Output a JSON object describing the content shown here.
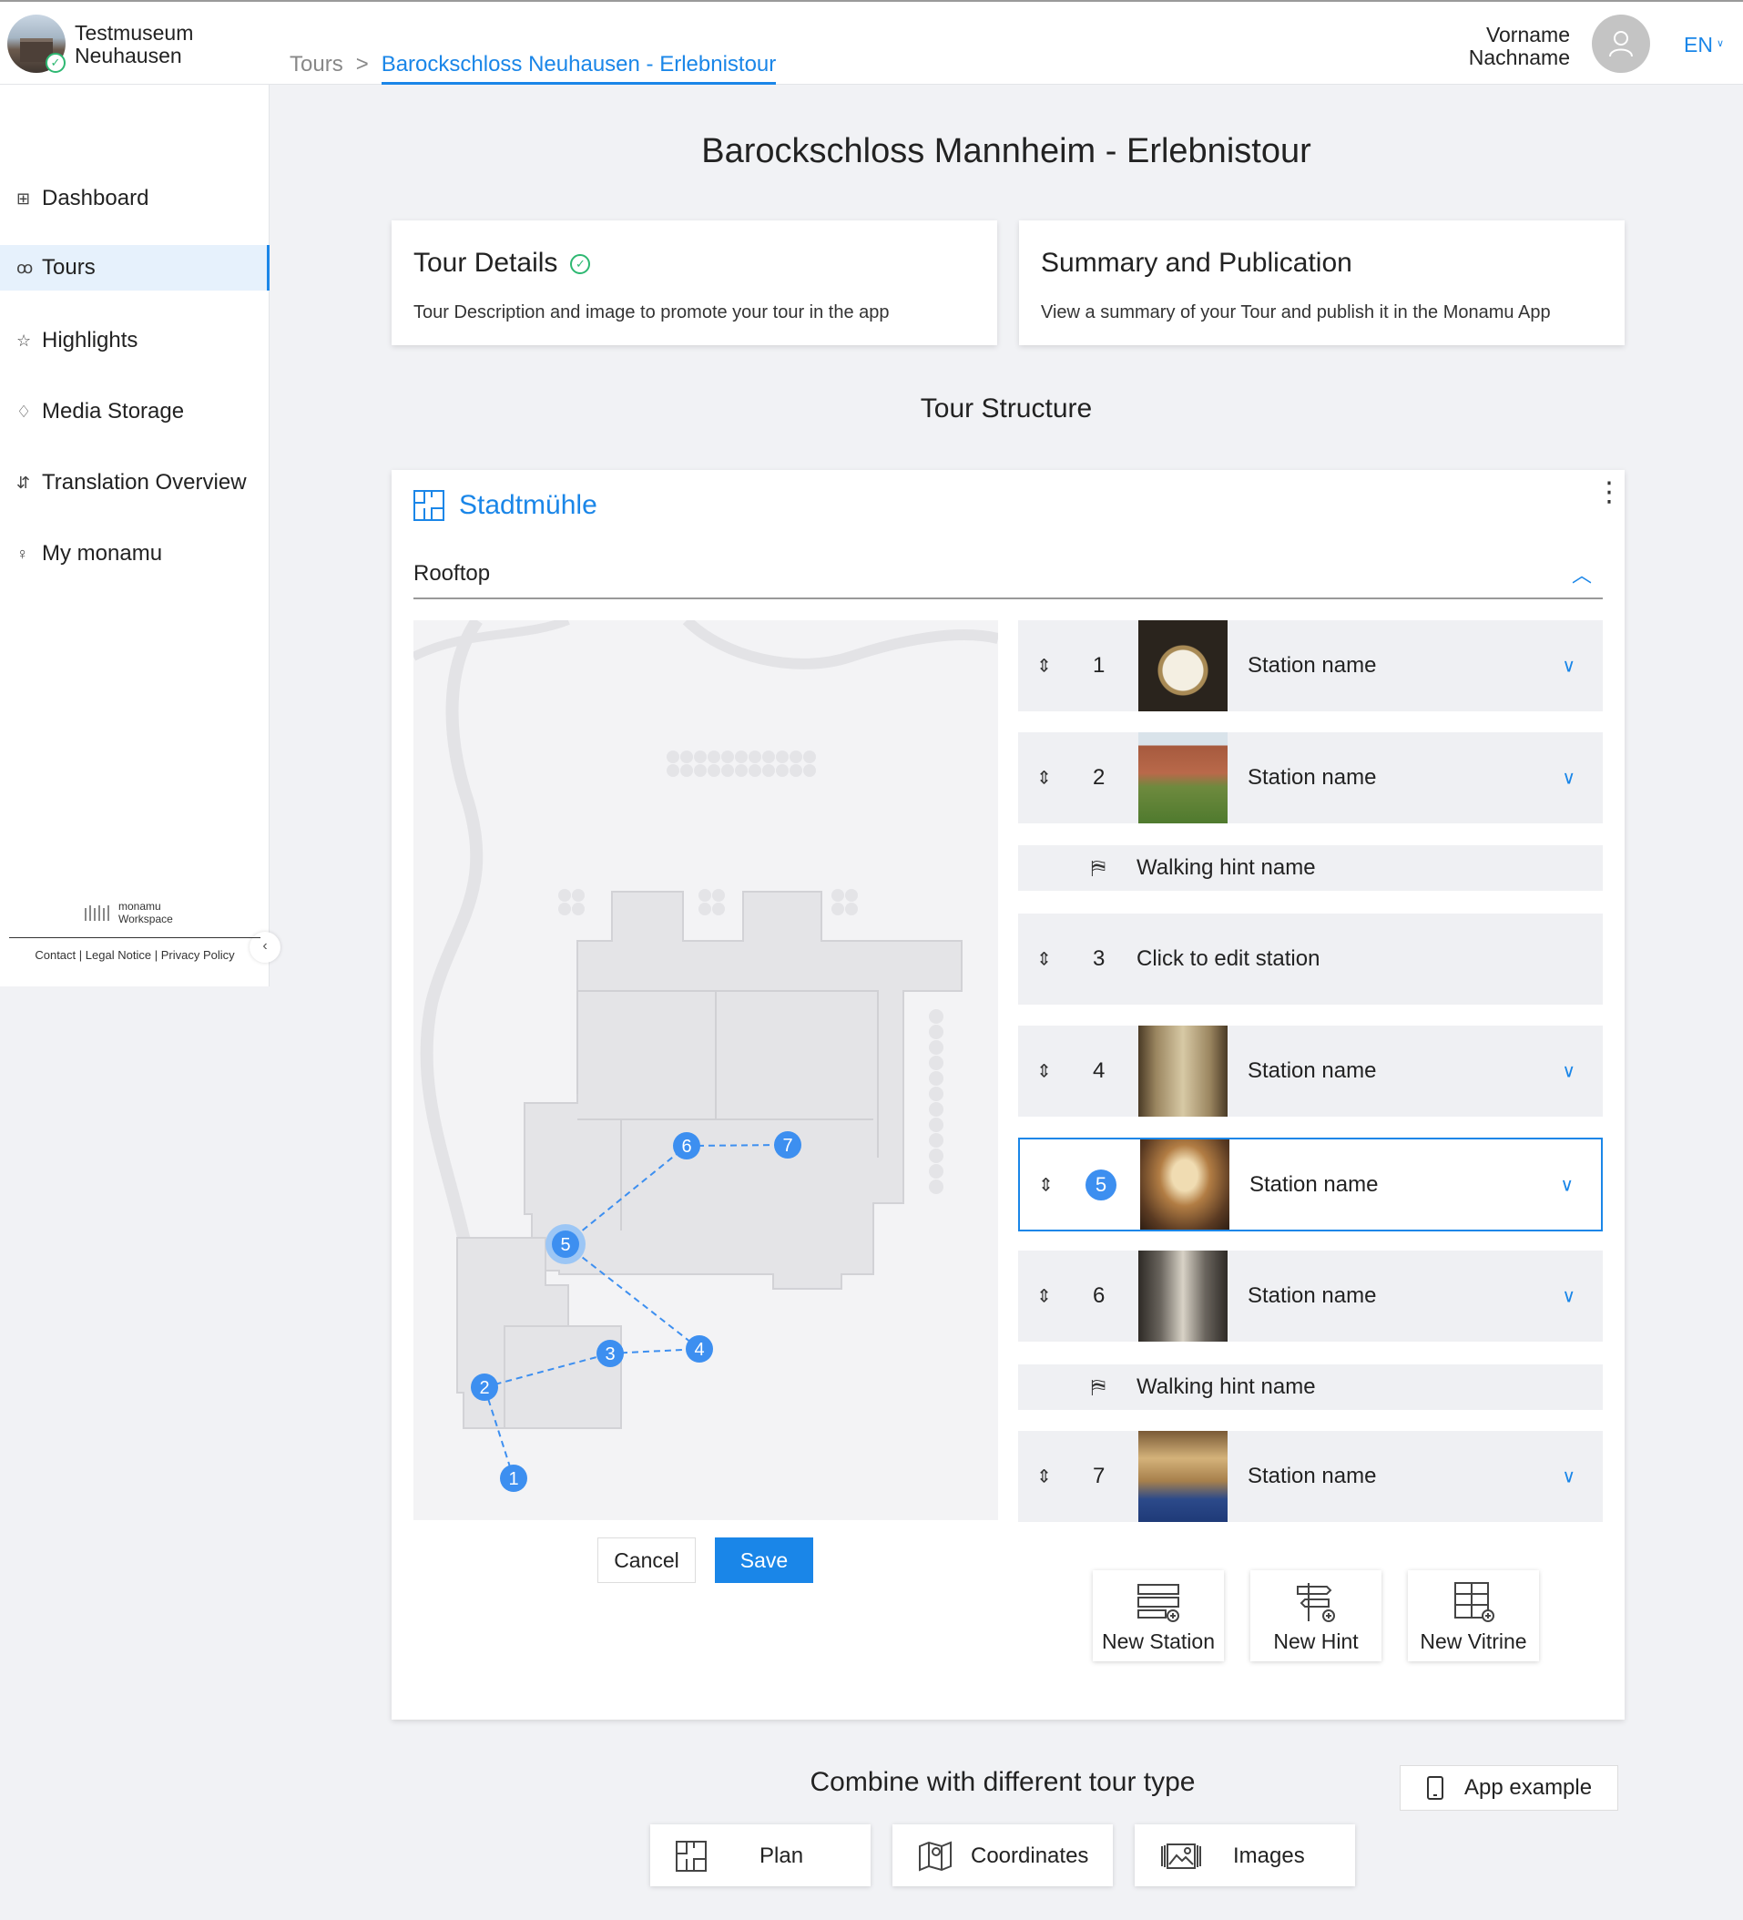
{
  "header": {
    "museum_name": "Testmuseum Neuhausen",
    "breadcrumb_root": "Tours",
    "breadcrumb_separator": ">",
    "breadcrumb_current": "Barockschloss Neuhausen - Erlebnistour",
    "user_first": "Vorname",
    "user_last": "Nachname",
    "language": "EN"
  },
  "sidebar": {
    "items": [
      {
        "label": "Dashboard",
        "icon": "grid-icon"
      },
      {
        "label": "Tours",
        "icon": "footprints-icon",
        "active": true
      },
      {
        "label": "Highlights",
        "icon": "star-icon"
      },
      {
        "label": "Media Storage",
        "icon": "diamond-icon"
      },
      {
        "label": "Translation Overview",
        "icon": "translate-icon"
      },
      {
        "label": "My monamu",
        "icon": "user-icon"
      }
    ],
    "workspace_brand": "monamu",
    "workspace_sub": "Workspace",
    "footer_contact": "Contact",
    "footer_legal": "Legal Notice",
    "footer_privacy": "Privacy Policy",
    "footer_sep": "|"
  },
  "page": {
    "title": "Barockschloss Mannheim - Erlebnistour",
    "tour_details_title": "Tour Details",
    "tour_details_desc": "Tour Description and image to promote your tour in the app",
    "summary_title": "Summary and Publication",
    "summary_desc": "View a summary of your Tour and publish it in the Monamu App",
    "structure_title": "Tour Structure"
  },
  "structure": {
    "plan_name": "Stadtmühle",
    "floor": "Rooftop",
    "cancel_label": "Cancel",
    "save_label": "Save",
    "map_markers": [
      "1",
      "2",
      "3",
      "4",
      "5",
      "6",
      "7"
    ],
    "rows": [
      {
        "type": "station",
        "num": "1",
        "name": "Station name"
      },
      {
        "type": "station",
        "num": "2",
        "name": "Station name"
      },
      {
        "type": "hint",
        "name": "Walking hint name"
      },
      {
        "type": "edit",
        "num": "3",
        "name": "Click to edit station"
      },
      {
        "type": "station",
        "num": "4",
        "name": "Station name"
      },
      {
        "type": "station",
        "num": "5",
        "name": "Station name",
        "selected": true
      },
      {
        "type": "station",
        "num": "6",
        "name": "Station name"
      },
      {
        "type": "hint",
        "name": "Walking hint name"
      },
      {
        "type": "station",
        "num": "7",
        "name": "Station name"
      }
    ],
    "new_station": "New Station",
    "new_hint": "New Hint",
    "new_vitrine": "New Vitrine"
  },
  "combine": {
    "title": "Combine with different tour type",
    "app_example": "App example",
    "plan": "Plan",
    "coordinates": "Coordinates",
    "images": "Images"
  },
  "colors": {
    "accent": "#1a86e8",
    "success": "#2eb872",
    "marker": "#3d8ff0"
  }
}
